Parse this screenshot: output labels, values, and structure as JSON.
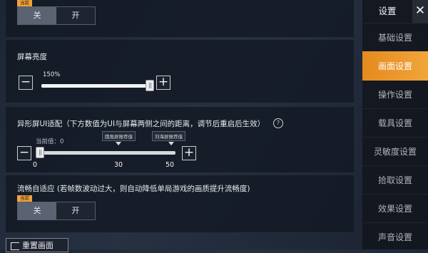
{
  "top_section": {
    "tag": "当前",
    "off_label": "关",
    "on_label": "开"
  },
  "brightness": {
    "title": "屏幕亮度",
    "value_text": "150%",
    "level_fraction": 1.0,
    "minus": "−",
    "plus": "+"
  },
  "notch": {
    "title": "异形屏UI适配（下方数值为UI与屏幕两侧之间的距离，调节后重启后生效）",
    "help_symbol": "?",
    "current_text": "当前值：0",
    "marker_rounded": "圆角屏推荐值",
    "marker_notch": "刘海屏推荐值",
    "min_label": "0",
    "mid_label": "30",
    "max_label": "50",
    "value": 0,
    "minus": "−",
    "plus": "+"
  },
  "smooth": {
    "title": "流畅自适应 (若帧数波动过大，则自动降低单局游戏的画质提升流畅度)",
    "tag": "当前",
    "off_label": "关",
    "on_label": "开"
  },
  "reset_button": "重置画面",
  "sidebar": {
    "title": "设置",
    "close_symbol": "✕",
    "items": [
      {
        "label": "基础设置"
      },
      {
        "label": "画面设置"
      },
      {
        "label": "操作设置"
      },
      {
        "label": "载具设置"
      },
      {
        "label": "灵敏度设置"
      },
      {
        "label": "拾取设置"
      },
      {
        "label": "效果设置"
      },
      {
        "label": "声音设置"
      }
    ],
    "active_index": 1
  },
  "colors": {
    "accent": "#f0a33a",
    "active_tab": "#e58a1e"
  }
}
